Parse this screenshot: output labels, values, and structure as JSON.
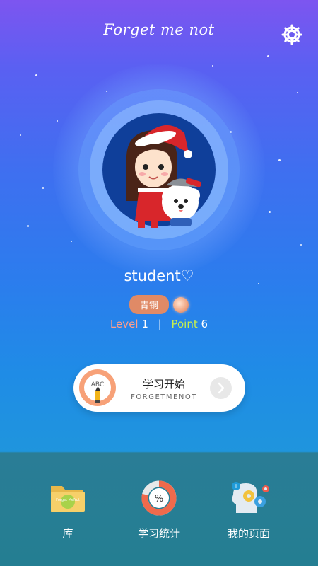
{
  "header": {
    "app_title": "Forget me not"
  },
  "profile": {
    "username": "student♡",
    "rank": "青铜",
    "level_label": "Level",
    "level_value": "1",
    "separator": "|",
    "point_label": "Point",
    "point_value": "6"
  },
  "start_card": {
    "icon_text": "ABC",
    "title": "学习开始",
    "subtitle": "FORGETMENOT"
  },
  "bottom_nav": {
    "items": [
      {
        "label": "库",
        "icon": "folder-icon",
        "icon_text": "Forget MeNot"
      },
      {
        "label": "学习统计",
        "icon": "stats-donut-icon",
        "icon_text": "%"
      },
      {
        "label": "我的页面",
        "icon": "head-gears-icon"
      }
    ]
  },
  "colors": {
    "rank_badge": "#e08a66",
    "level_label": "#ff9e8a",
    "point_label": "#c8f04c",
    "card_accent": "#f7a178"
  }
}
